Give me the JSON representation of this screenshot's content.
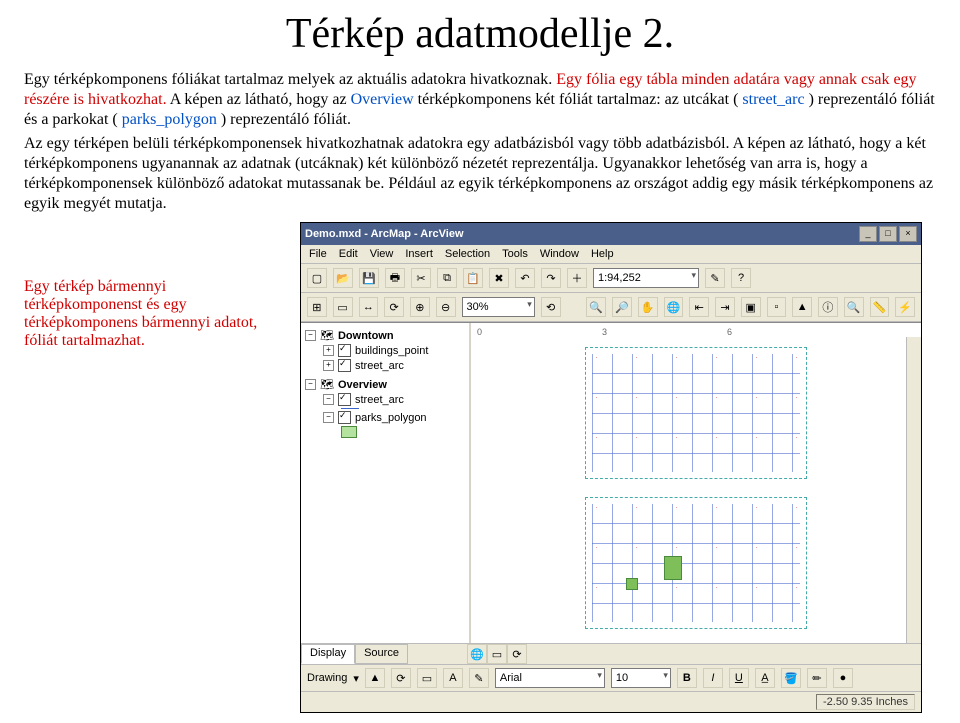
{
  "title": "Térkép adatmodellje 2.",
  "intro_sentence_parts": {
    "a": "Egy térképkomponens fóliákat tartalmaz melyek az aktuális adatokra hivatkoznak. ",
    "b_red": "Egy fólia egy tábla minden adatára vagy annak csak egy részére is hivatkozhat.",
    "c": " A képen az látható, hogy az ",
    "overview_blue": "Overview",
    "d": " térképkomponens két fóliát tartalmaz: az utcákat (",
    "street_blue": "street_arc",
    "e": ") reprezentáló fóliát és a parkokat (",
    "parks_blue": "parks_polygon",
    "f": ") reprezentáló fóliát."
  },
  "para2": "Az egy térképen belüli térképkomponensek hivatkozhatnak adatokra egy adatbázisból vagy több adatbázisból. A képen az látható, hogy a két térképkomponens ugyanannak az adatnak (utcáknak) két különböző nézetét reprezentálja. Ugyanakkor lehetőség van arra is, hogy a térképkomponensek különböző adatokat mutassanak be. Például az egyik térképkomponens az országot addig egy másik térképkomponens az egyik megyét mutatja.",
  "sidenote": "Egy térkép bármennyi térképkomponenst és egy térképkomponens bármennyi adatot, fóliát tartalmazhat.",
  "app": {
    "window_title": "Demo.mxd - ArcMap - ArcView",
    "menu": [
      "File",
      "Edit",
      "View",
      "Insert",
      "Selection",
      "Tools",
      "Window",
      "Help"
    ],
    "scale": "1:94,252",
    "zoom": "30%",
    "toc": {
      "frame1": {
        "name": "Downtown",
        "layers": [
          "buildings_point",
          "street_arc"
        ]
      },
      "frame2": {
        "name": "Overview",
        "layers": [
          "street_arc",
          "parks_polygon"
        ]
      }
    },
    "tabs": {
      "display": "Display",
      "source": "Source"
    },
    "ruler_marks": [
      "0",
      "3",
      "6"
    ],
    "drawing": {
      "label": "Drawing",
      "font": "Arial",
      "size": "10",
      "style_b": "B",
      "style_i": "I",
      "style_u": "U"
    },
    "status": "-2.50  9.35 Inches"
  }
}
